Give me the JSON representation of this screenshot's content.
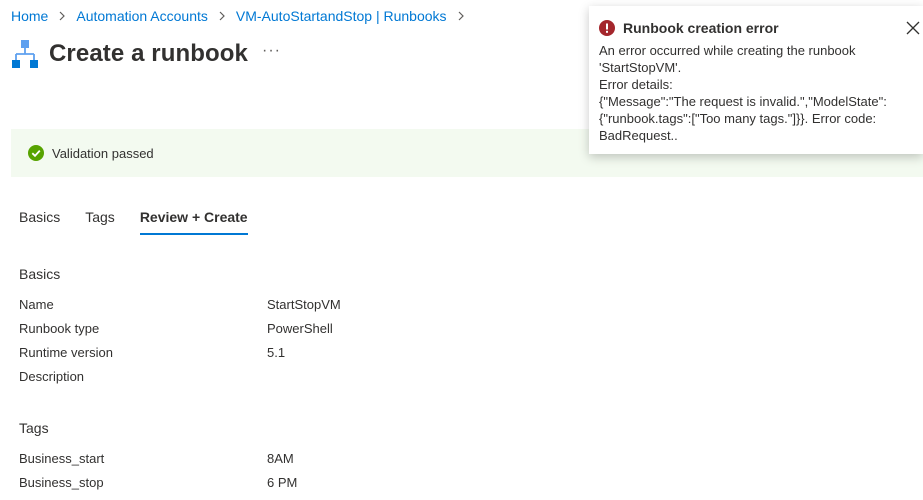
{
  "breadcrumb": {
    "items": [
      "Home",
      "Automation Accounts",
      "VM-AutoStartandStop | Runbooks"
    ]
  },
  "header": {
    "title": "Create a runbook",
    "more": "···"
  },
  "validation": {
    "text": "Validation passed"
  },
  "tabs": [
    {
      "label": "Basics"
    },
    {
      "label": "Tags"
    },
    {
      "label": "Review + Create"
    }
  ],
  "basics": {
    "title": "Basics",
    "rows": [
      {
        "label": "Name",
        "value": "StartStopVM"
      },
      {
        "label": "Runbook type",
        "value": "PowerShell"
      },
      {
        "label": "Runtime version",
        "value": "5.1"
      },
      {
        "label": "Description",
        "value": ""
      }
    ]
  },
  "tags": {
    "title": "Tags",
    "rows": [
      {
        "label": "Business_start",
        "value": "8AM"
      },
      {
        "label": "Business_stop",
        "value": "6 PM"
      }
    ]
  },
  "toast": {
    "title": "Runbook creation error",
    "lines": [
      "An error occurred while creating the runbook",
      "'StartStopVM'.",
      "Error details:",
      "{\"Message\":\"The request is invalid.\",\"ModelState\":",
      "{\"runbook.tags\":[\"Too many tags.\"]}}. Error code:",
      "BadRequest.."
    ]
  },
  "colors": {
    "link": "#0078d4",
    "success": "#57a300",
    "error": "#a4262c",
    "banner_bg": "#f3faf0"
  }
}
